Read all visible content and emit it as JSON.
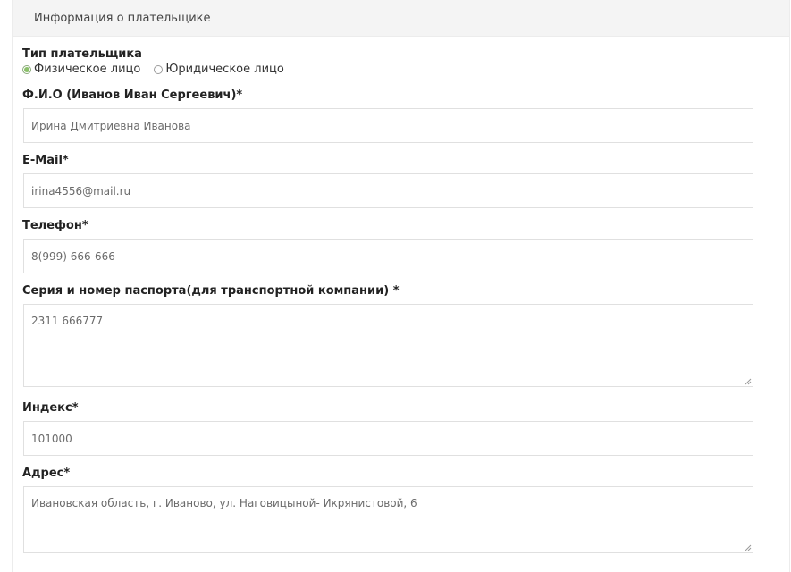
{
  "section": {
    "title": "Информация о плательщике"
  },
  "payer_type": {
    "label": "Тип плательщика",
    "options": [
      {
        "label": "Физическое лицо",
        "selected": true
      },
      {
        "label": "Юридическое лицо",
        "selected": false
      }
    ]
  },
  "fields": {
    "fio": {
      "label": "Ф.И.О (Иванов Иван Сергеевич)*",
      "value": "Ирина Дмитриевна Иванова"
    },
    "email": {
      "label": "E-Mail*",
      "value": "irina4556@mail.ru"
    },
    "phone": {
      "label": "Телефон*",
      "value": "8(999) 666-666"
    },
    "passport": {
      "label": "Серия и номер паспорта(для транспортной компании) *",
      "value": "2311 666777"
    },
    "index": {
      "label": "Индекс*",
      "value": "101000"
    },
    "address": {
      "label": "Адрес*",
      "value": "Ивановская область, г. Иваново, ул.  Наговицыной- Икрянистовой, 6"
    }
  },
  "colors": {
    "radio_selected": "#8bc06a",
    "header_bg": "#f4f4f4",
    "field_border": "#e0e0e0"
  }
}
